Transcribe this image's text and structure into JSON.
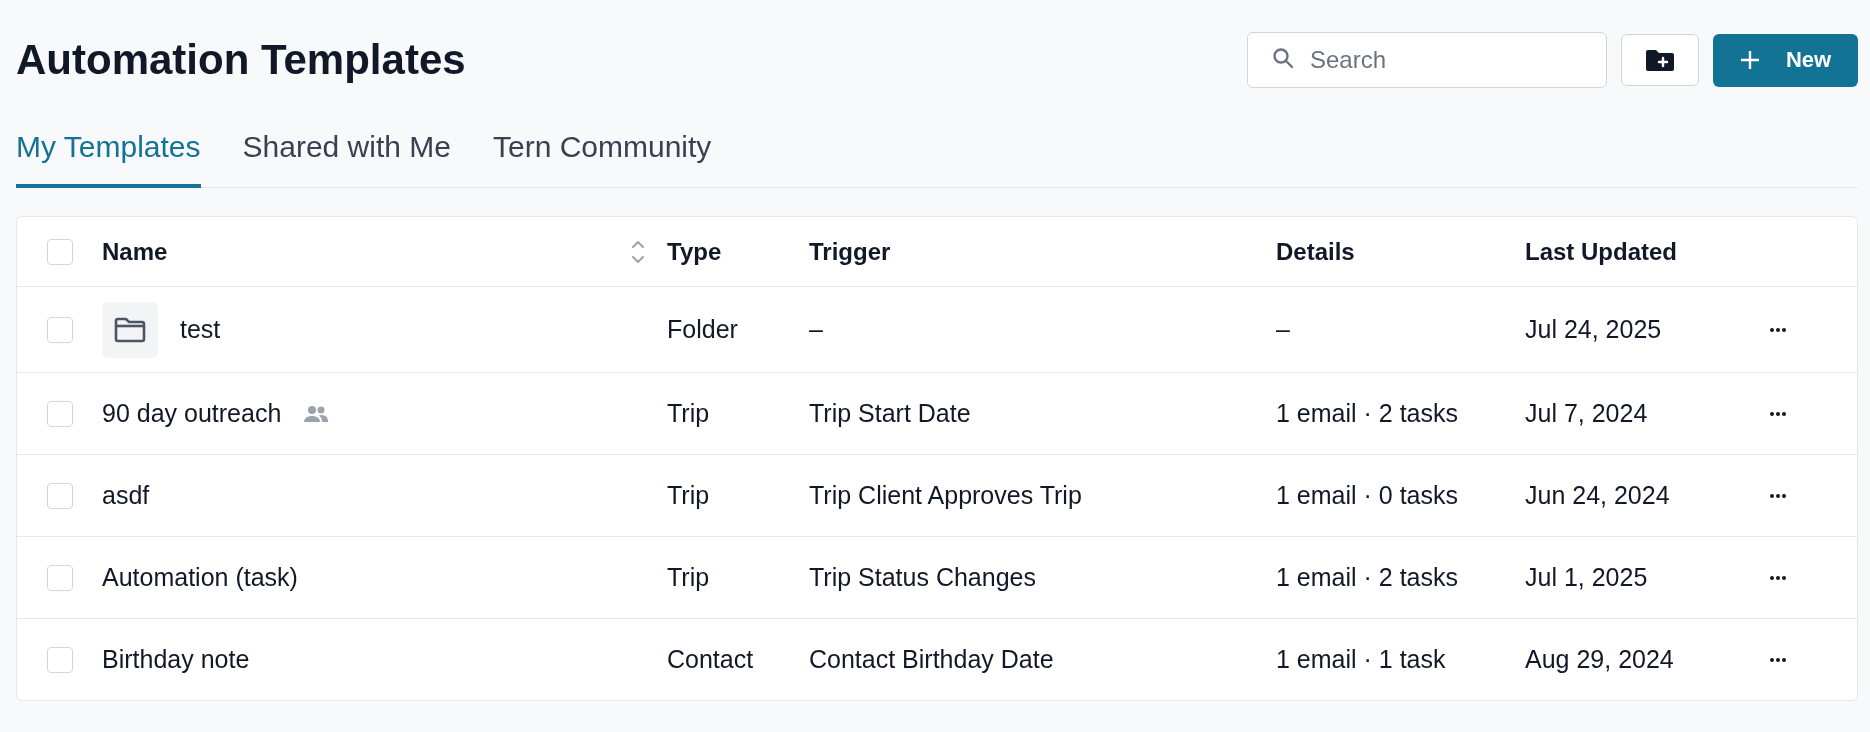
{
  "title": "Automation Templates",
  "search": {
    "placeholder": "Search"
  },
  "new_button": {
    "label": "New"
  },
  "tabs": [
    {
      "label": "My Templates",
      "selected": true
    },
    {
      "label": "Shared with Me",
      "selected": false
    },
    {
      "label": "Tern Community",
      "selected": false
    }
  ],
  "table": {
    "select_all": {
      "checked": false
    },
    "columns": [
      "Name",
      "Type",
      "Trigger",
      "Details",
      "Last Updated"
    ],
    "rows": [
      {
        "kind": "folder",
        "name": "test",
        "shared": false,
        "type": "Folder",
        "trigger": "–",
        "details": "–",
        "last_updated": "Jul 24, 2025",
        "checked": false
      },
      {
        "kind": "template",
        "name": "90 day outreach",
        "shared": true,
        "type": "Trip",
        "trigger": "Trip Start Date",
        "details": "1 email · 2 tasks",
        "last_updated": "Jul 7, 2024",
        "checked": false
      },
      {
        "kind": "template",
        "name": "asdf",
        "shared": false,
        "type": "Trip",
        "trigger": "Trip Client Approves Trip",
        "details": "1 email · 0 tasks",
        "last_updated": "Jun 24, 2024",
        "checked": false
      },
      {
        "kind": "template",
        "name": "Automation (task)",
        "shared": false,
        "type": "Trip",
        "trigger": "Trip Status Changes",
        "details": "1 email · 2 tasks",
        "last_updated": "Jul 1, 2025",
        "checked": false
      },
      {
        "kind": "template",
        "name": "Birthday note",
        "shared": false,
        "type": "Contact",
        "trigger": "Contact Birthday Date",
        "details": "1 email · 1 task",
        "last_updated": "Aug 29, 2024",
        "checked": false
      }
    ]
  }
}
